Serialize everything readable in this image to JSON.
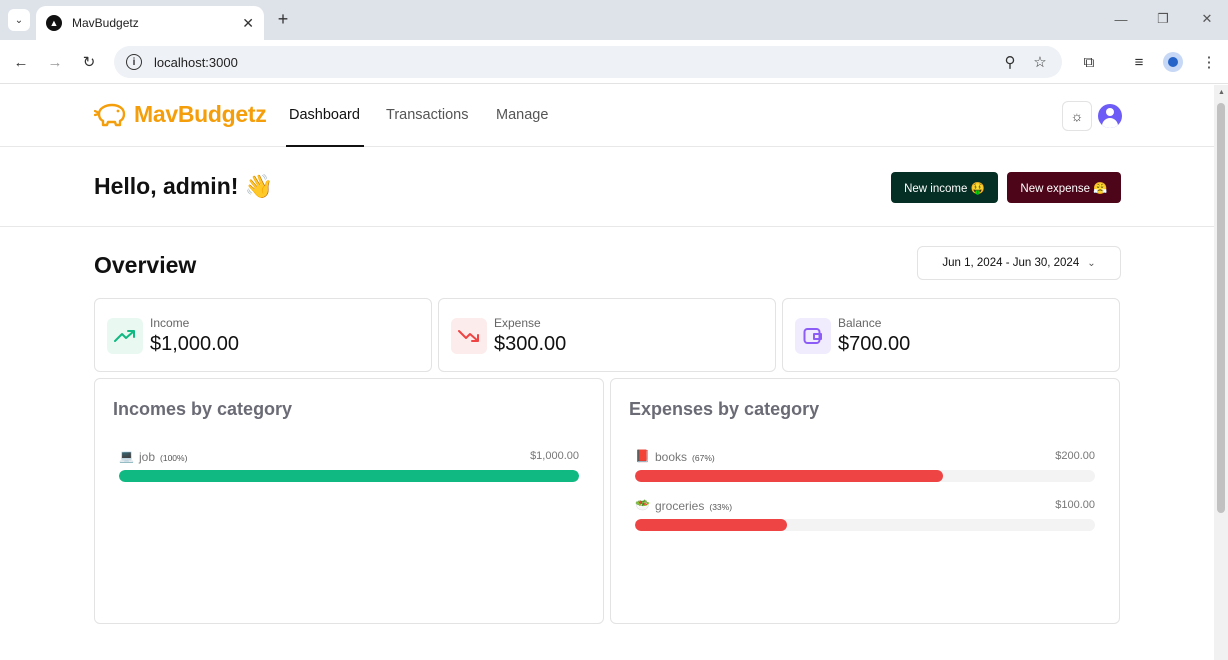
{
  "browser": {
    "tab_title": "MavBudgetz",
    "url": "localhost:3000"
  },
  "app": {
    "brand": "MavBudgetz",
    "nav": [
      {
        "label": "Dashboard",
        "active": true
      },
      {
        "label": "Transactions",
        "active": false
      },
      {
        "label": "Manage",
        "active": false
      }
    ]
  },
  "greeting": {
    "text": "Hello, admin! 👋",
    "new_income_label": "New income 🤑",
    "new_expense_label": "New expense 😤"
  },
  "overview": {
    "title": "Overview",
    "date_range": "Jun 1, 2024 - Jun 30, 2024"
  },
  "stats": [
    {
      "label": "Income",
      "value": "$1,000.00",
      "icon": "trending-up-icon",
      "color": "#10b981",
      "bg": "#e9f9f1"
    },
    {
      "label": "Expense",
      "value": "$300.00",
      "icon": "trending-down-icon",
      "color": "#ef4444",
      "bg": "#fdecec"
    },
    {
      "label": "Balance",
      "value": "$700.00",
      "icon": "wallet-icon",
      "color": "#8b5cf6",
      "bg": "#f1ecfd"
    }
  ],
  "incomes_by_category": {
    "title": "Incomes by category",
    "items": [
      {
        "emoji": "💻",
        "name": "job",
        "pct_label": "(100%)",
        "amount": "$1,000.00",
        "fraction": 1.0,
        "color": "#10b981"
      }
    ]
  },
  "expenses_by_category": {
    "title": "Expenses by category",
    "items": [
      {
        "emoji": "📕",
        "name": "books",
        "pct_label": "(67%)",
        "amount": "$200.00",
        "fraction": 0.67,
        "color": "#ef4444"
      },
      {
        "emoji": "🥗",
        "name": "groceries",
        "pct_label": "(33%)",
        "amount": "$100.00",
        "fraction": 0.33,
        "color": "#ef4444"
      }
    ]
  }
}
